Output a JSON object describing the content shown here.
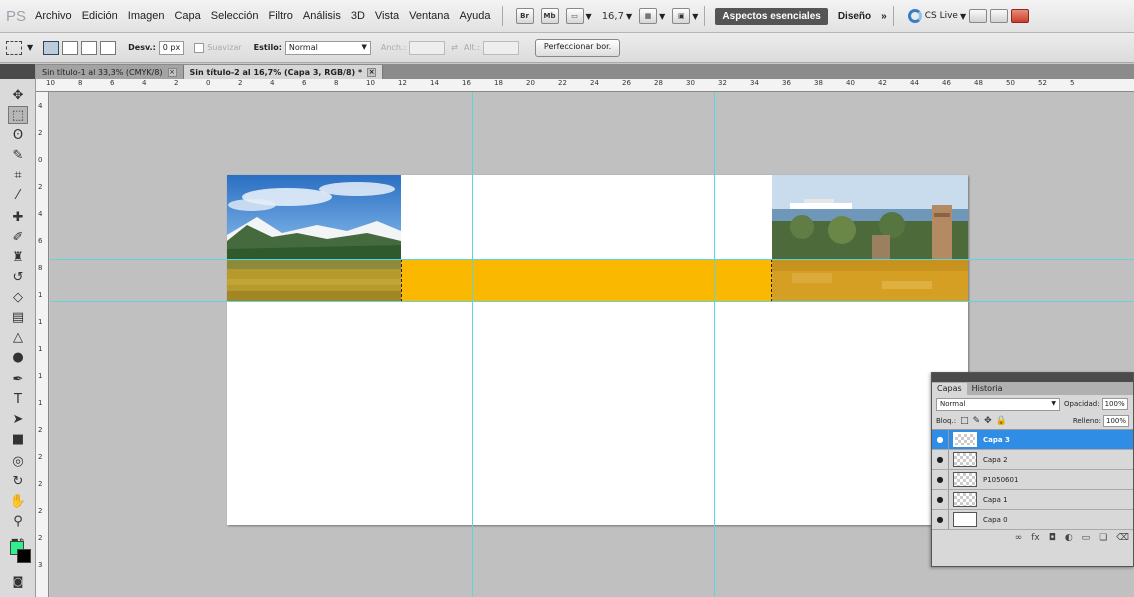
{
  "app": {
    "logo": "PS",
    "menu": [
      "Archivo",
      "Edición",
      "Imagen",
      "Capa",
      "Selección",
      "Filtro",
      "Análisis",
      "3D",
      "Vista",
      "Ventana",
      "Ayuda"
    ],
    "bridge_label": "Br",
    "minibridge_label": "Mb",
    "zoom": "16,7",
    "workspaces": {
      "active": "Aspectos esenciales",
      "other": "Diseño",
      "more": "»"
    },
    "cslive": "CS Live"
  },
  "options": {
    "feather_label": "Desv.:",
    "feather_value": "0 px",
    "antialias_label": "Suavizar",
    "style_label": "Estilo:",
    "style_value": "Normal",
    "width_label": "Anch.:",
    "height_label": "Alt.:",
    "refine_label": "Perfeccionar bor."
  },
  "tabs": [
    {
      "label": "Sin título-1 al 33,3% (CMYK/8)",
      "active": false
    },
    {
      "label": "Sin título-2 al 16,7% (Capa 3, RGB/8) *",
      "active": true
    }
  ],
  "ruler": {
    "h_ticks": [
      "10",
      "8",
      "6",
      "4",
      "2",
      "0",
      "2",
      "4",
      "6",
      "8",
      "10",
      "12",
      "14",
      "16",
      "18",
      "20",
      "22",
      "24",
      "26",
      "28",
      "30",
      "32",
      "34",
      "36",
      "38",
      "40",
      "42",
      "44",
      "46",
      "48",
      "50",
      "52",
      "5"
    ],
    "v_ticks": [
      "4",
      "2",
      "0",
      "2",
      "4",
      "6",
      "8",
      "1",
      "1",
      "1",
      "1",
      "1",
      "2",
      "2",
      "2",
      "2",
      "2",
      "3"
    ]
  },
  "tools": [
    "move-tool",
    "marquee-tool",
    "lasso-tool",
    "quick-select-tool",
    "crop-tool",
    "eyedropper-tool",
    "spot-healing-tool",
    "brush-tool",
    "clone-stamp-tool",
    "history-brush-tool",
    "eraser-tool",
    "gradient-tool",
    "blur-tool",
    "dodge-tool",
    "pen-tool",
    "type-tool",
    "path-select-tool",
    "shape-tool",
    "3d-rotate-tool",
    "3d-orbit-tool",
    "hand-tool",
    "zoom-tool"
  ],
  "colors": {
    "foreground": "#2ff08c",
    "background": "#000000",
    "selection_fill": "#fbb800",
    "guide": "#5fd4dc",
    "layer_selected": "#2f8de6"
  },
  "layers_panel": {
    "tabs": [
      "Capas",
      "Historia"
    ],
    "blend_mode": "Normal",
    "opacity_label": "Opacidad:",
    "opacity_value": "100%",
    "lock_label": "Bloq.:",
    "fill_label": "Relleno:",
    "fill_value": "100%",
    "layers": [
      {
        "name": "Capa 3",
        "selected": true
      },
      {
        "name": "Capa 2",
        "selected": false
      },
      {
        "name": "P1050601",
        "selected": false
      },
      {
        "name": "Capa 1",
        "selected": false
      },
      {
        "name": "Capa 0",
        "selected": false
      }
    ]
  }
}
